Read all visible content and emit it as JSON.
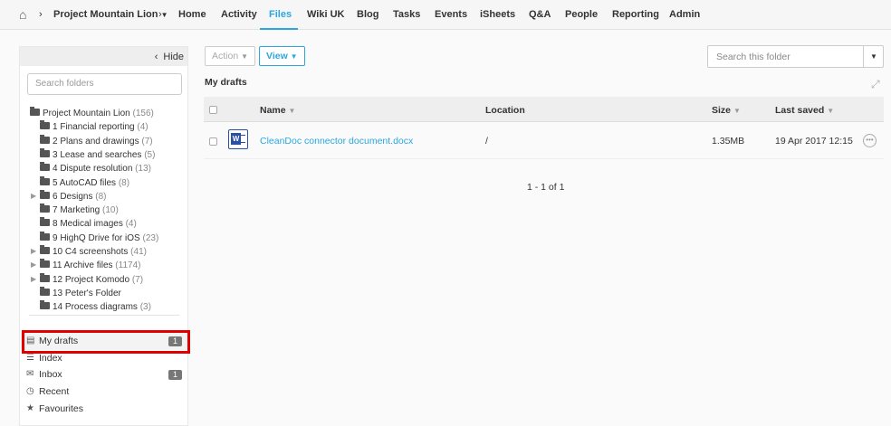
{
  "topbar": {
    "breadcrumb_project": "Project Mountain Lion",
    "nav": [
      "Home",
      "Activity",
      "Files",
      "Wiki UK",
      "Blog",
      "Tasks",
      "Events",
      "iSheets",
      "Q&A",
      "People",
      "Reporting",
      "Admin"
    ],
    "active": "Files"
  },
  "sidebar": {
    "hide_label": "Hide",
    "search_placeholder": "Search folders",
    "root": {
      "label": "Project Mountain Lion",
      "count": "(156)"
    },
    "folders": [
      {
        "label": "1 Financial reporting",
        "count": "(4)",
        "expandable": false
      },
      {
        "label": "2 Plans and drawings",
        "count": "(7)",
        "expandable": false
      },
      {
        "label": "3 Lease and searches",
        "count": "(5)",
        "expandable": false
      },
      {
        "label": "4 Dispute resolution",
        "count": "(13)",
        "expandable": false
      },
      {
        "label": "5 AutoCAD files",
        "count": "(8)",
        "expandable": false
      },
      {
        "label": "6 Designs",
        "count": "(8)",
        "expandable": true
      },
      {
        "label": "7 Marketing",
        "count": "(10)",
        "expandable": false
      },
      {
        "label": "8 Medical images",
        "count": "(4)",
        "expandable": false
      },
      {
        "label": "9 HighQ Drive for iOS",
        "count": "(23)",
        "expandable": false
      },
      {
        "label": "10 C4 screenshots",
        "count": "(41)",
        "expandable": true
      },
      {
        "label": "11 Archive files",
        "count": "(1174)",
        "expandable": true
      },
      {
        "label": "12 Project Komodo",
        "count": "(7)",
        "expandable": true
      },
      {
        "label": "13 Peter's Folder",
        "count": "",
        "expandable": false
      },
      {
        "label": "14 Process diagrams",
        "count": "(3)",
        "expandable": false
      }
    ],
    "nav": [
      {
        "label": "My drafts",
        "badge": "1",
        "icon": "file-icon"
      },
      {
        "label": "Index",
        "badge": "",
        "icon": "list-icon"
      },
      {
        "label": "Inbox",
        "badge": "1",
        "icon": "envelope-icon"
      },
      {
        "label": "Recent",
        "badge": "",
        "icon": "clock-icon"
      },
      {
        "label": "Favourites",
        "badge": "",
        "icon": "star-icon"
      }
    ]
  },
  "toolbar": {
    "action_label": "Action",
    "view_label": "View",
    "search_placeholder": "Search this folder"
  },
  "main": {
    "title": "My drafts",
    "columns": {
      "name": "Name",
      "location": "Location",
      "size": "Size",
      "last_saved": "Last saved"
    },
    "rows": [
      {
        "name": "CleanDoc connector document.docx",
        "location": "/",
        "size": "1.35MB",
        "last_saved": "19 Apr 2017 12:15"
      }
    ],
    "pager": "1 - 1 of 1"
  },
  "colors": {
    "accent": "#29a8e0",
    "highlight": "#e00000"
  }
}
